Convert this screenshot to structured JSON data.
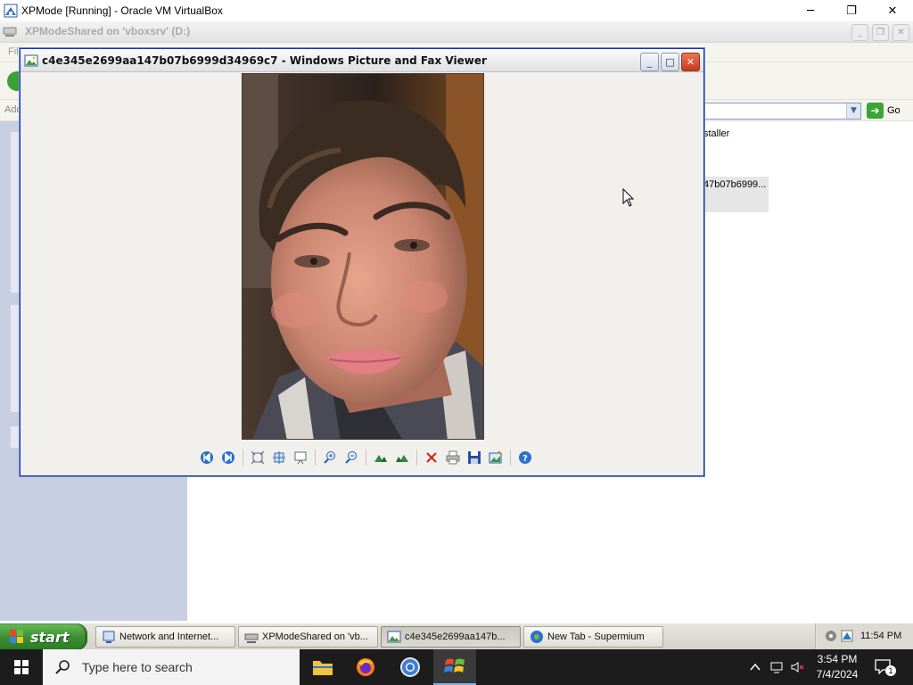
{
  "host_window": {
    "title": "XPMode [Running] - Oracle VM VirtualBox",
    "controls": {
      "minimize": "─",
      "restore": "❐",
      "close": "✕"
    }
  },
  "explorer_window": {
    "title": "XPModeShared on 'vboxsrv' (D:)",
    "menu_partial": "Fil",
    "address_partial": "Add",
    "go_label": "Go",
    "file_item_1": "staller",
    "file_item_2": "47b07b6999..."
  },
  "viewer_window": {
    "title": "c4e345e2699aa147b07b6999d34969c7 - Windows Picture and Fax Viewer",
    "toolbar": [
      "previous-image",
      "next-image",
      "best-fit",
      "actual-size",
      "slide-show",
      "zoom-in",
      "zoom-out",
      "rotate-clockwise",
      "rotate-counterclockwise",
      "delete",
      "print",
      "copy-to",
      "open-for-editing",
      "help"
    ]
  },
  "xp_taskbar": {
    "start_label": "start",
    "tasks": [
      {
        "label": "Network and Internet...",
        "icon": "network-icon",
        "active": false
      },
      {
        "label": "XPModeShared on 'vb...",
        "icon": "network-drive-icon",
        "active": false
      },
      {
        "label": "c4e345e2699aa147b...",
        "icon": "picture-viewer-icon",
        "active": true
      },
      {
        "label": "New Tab - Supermium",
        "icon": "browser-icon",
        "active": false
      }
    ],
    "clock": "11:54 PM"
  },
  "win10_taskbar": {
    "search_placeholder": "Type here to search",
    "apps": [
      "file-explorer-icon",
      "firefox-icon",
      "chrome-icon",
      "xp-mode-icon"
    ],
    "time": "3:54 PM",
    "date": "7/4/2024",
    "notification_count": "1"
  },
  "colors": {
    "xp_start_green": "#3c8f33",
    "win10_taskbar": "#1c1c1c",
    "viewer_bg": "#f1f0ec"
  }
}
